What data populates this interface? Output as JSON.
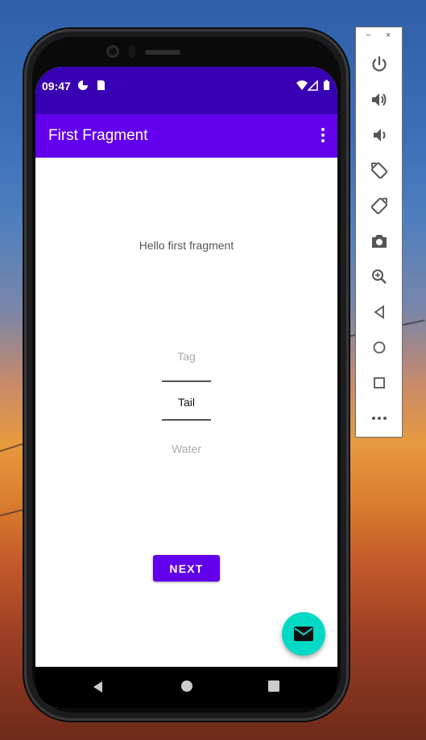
{
  "status_bar": {
    "time": "09:47"
  },
  "app_bar": {
    "title": "First Fragment"
  },
  "content": {
    "hello_text": "Hello first fragment",
    "picker": {
      "above": "Tag",
      "selected": "Tail",
      "below": "Water"
    },
    "next_label": "NEXT"
  },
  "emulator_toolbar": {
    "minimize": "−",
    "close": "×",
    "buttons": [
      "power",
      "volume-up",
      "volume-down",
      "rotate-left",
      "rotate-right",
      "screenshot",
      "zoom",
      "back",
      "home",
      "overview",
      "more"
    ]
  },
  "colors": {
    "status_bar": "#3700b3",
    "primary": "#6200ee",
    "fab": "#03dac5"
  }
}
